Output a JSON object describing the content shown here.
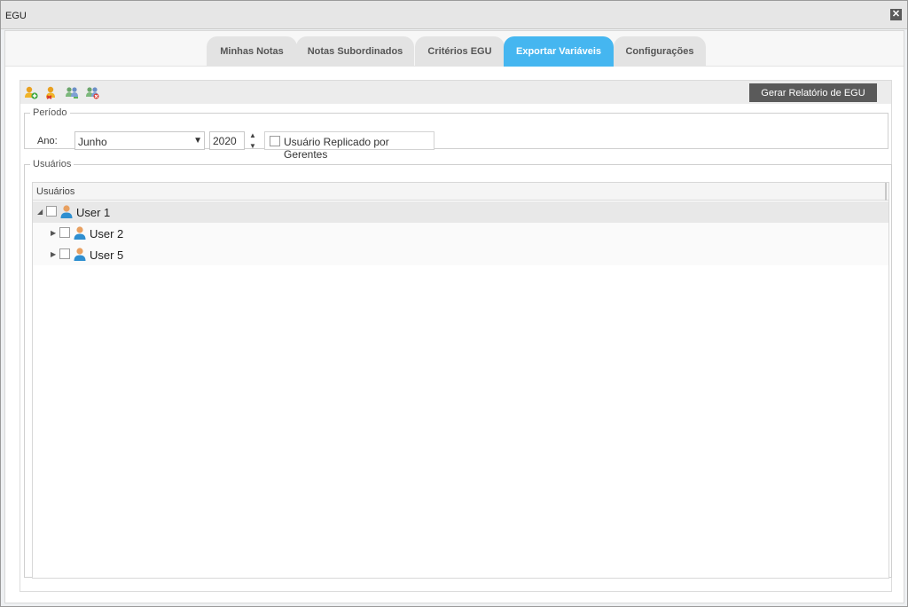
{
  "window": {
    "title": "EGU",
    "close_label": "✕"
  },
  "tabs": [
    {
      "label": "Minhas Notas",
      "active": false
    },
    {
      "label": "Notas Subordinados",
      "active": false
    },
    {
      "label": "Critérios EGU",
      "active": false
    },
    {
      "label": "Exportar Variáveis",
      "active": true
    },
    {
      "label": "Configurações",
      "active": false
    }
  ],
  "toolbar": {
    "icons": [
      "add-user-icon",
      "remove-user-icon",
      "group-icon",
      "group-remove-icon"
    ],
    "report_button": "Gerar Relatório de EGU"
  },
  "periodo": {
    "legend": "Período",
    "ano_label": "Ano:",
    "month": "Junho",
    "year": "2020",
    "replicado_label": "Usuário Replicado por Gerentes",
    "replicado_checked": false
  },
  "usuarios": {
    "legend": "Usuários",
    "column_header": "Usuários",
    "rows": [
      {
        "name": "User 1",
        "expanded": true,
        "level": 0,
        "checked": false
      },
      {
        "name": "User 2",
        "expanded": false,
        "level": 1,
        "checked": false
      },
      {
        "name": "User 5",
        "expanded": false,
        "level": 1,
        "checked": false
      }
    ]
  },
  "colors": {
    "accent": "#45b6f0",
    "button_dark": "#5a5a5a",
    "tab_inactive": "#e3e3e3"
  }
}
